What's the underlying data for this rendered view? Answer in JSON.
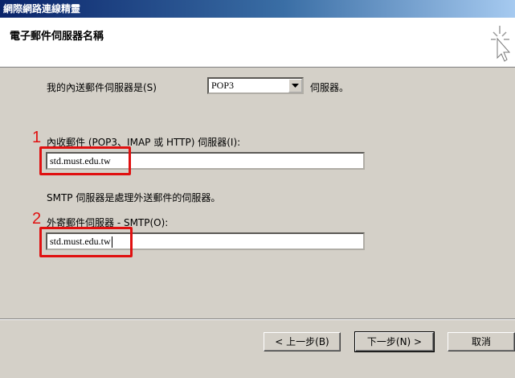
{
  "window": {
    "title": "網際網路連線精靈"
  },
  "header": {
    "title": "電子郵件伺服器名稱",
    "icon": "wizard-cursor-icon"
  },
  "incoming_type": {
    "prefix": "我的內送郵件伺服器是(S)",
    "selected": "POP3",
    "suffix": "伺服器。"
  },
  "incoming": {
    "step": "1",
    "label": "內收郵件 (POP3、IMAP 或 HTTP) 伺服器(I):",
    "value": "std.must.edu.tw"
  },
  "smtp_note": "SMTP 伺服器是處理外送郵件的伺服器。",
  "outgoing": {
    "step": "2",
    "label": "外寄郵件伺服器 - SMTP(O):",
    "value": "std.must.edu.tw"
  },
  "buttons": {
    "back": "< 上一步(B)",
    "next": "下一步(N) >",
    "cancel": "取消"
  },
  "colors": {
    "highlight_red": "#e01010",
    "dialog_bg": "#d4d0c8",
    "title_blue": "#0a246a"
  }
}
